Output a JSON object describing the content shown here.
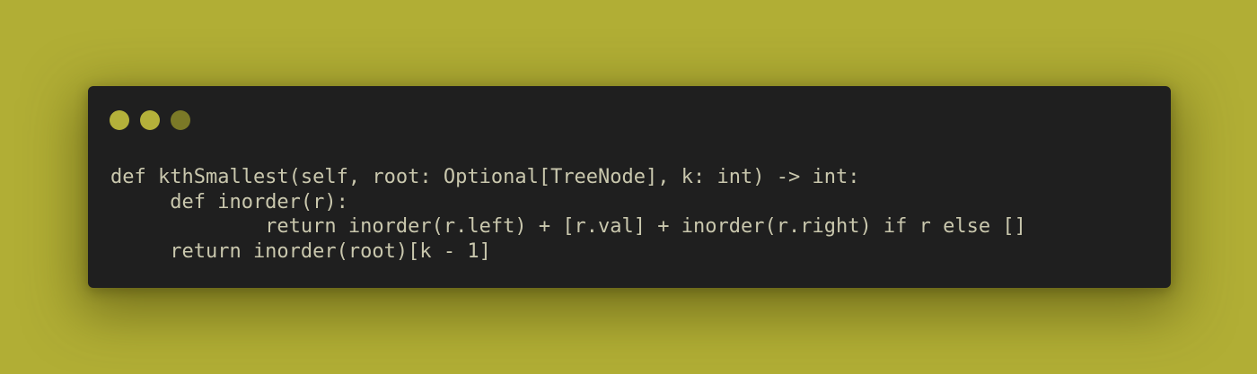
{
  "window": {
    "controls": [
      {
        "name": "close-dot",
        "color": "#b4b13a"
      },
      {
        "name": "minimize-dot",
        "color": "#b4b13a"
      },
      {
        "name": "maximize-dot",
        "color": "#7b7927"
      }
    ]
  },
  "colors": {
    "background": "#b1ae35",
    "panel": "#1f1f1f",
    "code_text": "#c9c7ad"
  },
  "code": {
    "language": "python",
    "lines": [
      "def kthSmallest(self, root: Optional[TreeNode], k: int) -> int:",
      "     def inorder(r):",
      "             return inorder(r.left) + [r.val] + inorder(r.right) if r else []",
      "     return inorder(root)[k - 1]"
    ]
  }
}
